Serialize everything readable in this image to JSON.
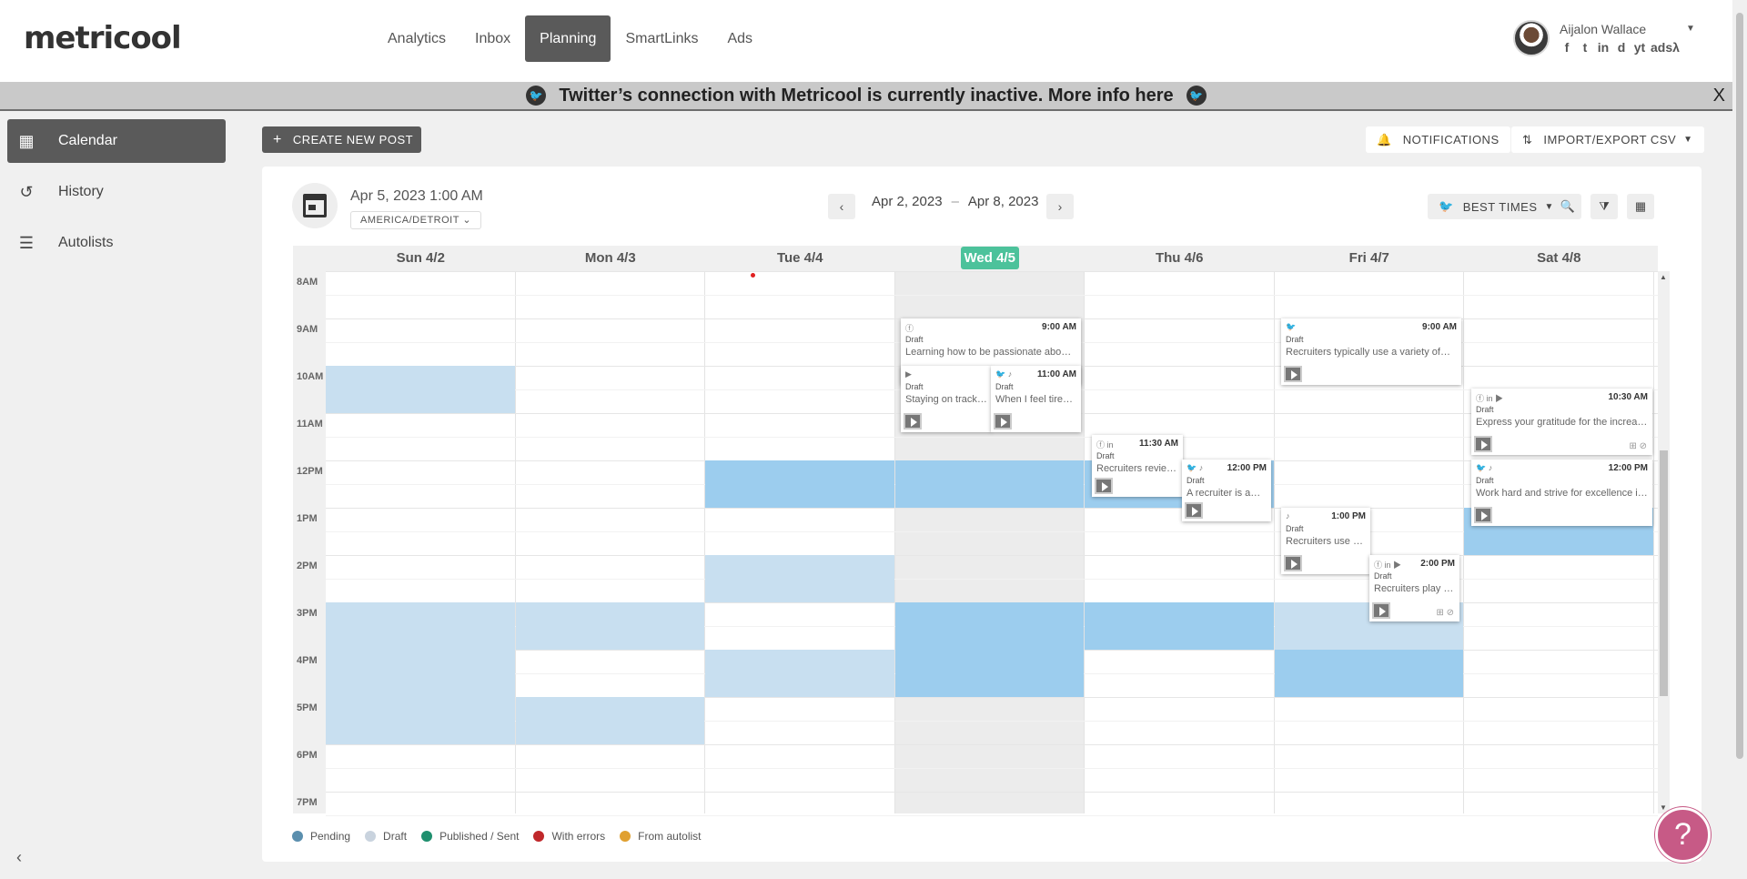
{
  "app": {
    "logo": "metricool"
  },
  "nav": [
    {
      "label": "Analytics",
      "active": false
    },
    {
      "label": "Inbox",
      "active": false
    },
    {
      "label": "Planning",
      "active": true
    },
    {
      "label": "SmartLinks",
      "active": false
    },
    {
      "label": "Ads",
      "active": false
    }
  ],
  "user": {
    "name": "Aijalon Wallace",
    "networks": [
      "f",
      "t",
      "in",
      "d",
      "yt",
      "ads",
      "λ"
    ]
  },
  "banner": {
    "text": "Twitter’s connection with Metricool is currently inactive. More info here",
    "close": "X"
  },
  "sidebar": {
    "items": [
      {
        "label": "Calendar",
        "icon": "calendar-icon",
        "active": true
      },
      {
        "label": "History",
        "icon": "history-icon",
        "active": false
      },
      {
        "label": "Autolists",
        "icon": "list-icon",
        "active": false
      }
    ],
    "collapse": "‹"
  },
  "toolbar": {
    "create": "CREATE NEW POST",
    "notifications": "NOTIFICATIONS",
    "import_export": "IMPORT/EXPORT CSV"
  },
  "calendar": {
    "now": "Apr 5, 2023 1:00 AM",
    "timezone": "AMERICA/DETROIT",
    "range_start": "Apr 2, 2023",
    "range_sep": "–",
    "range_end": "Apr 8, 2023",
    "best_times": "BEST TIMES",
    "days": [
      {
        "label": "Sun 4/2",
        "today": false
      },
      {
        "label": "Mon 4/3",
        "today": false
      },
      {
        "label": "Tue 4/4",
        "today": false
      },
      {
        "label": "Wed 4/5",
        "today": true
      },
      {
        "label": "Thu 4/6",
        "today": false
      },
      {
        "label": "Fri 4/7",
        "today": false
      },
      {
        "label": "Sat 4/8",
        "today": false
      }
    ],
    "hours": [
      "8AM",
      "9AM",
      "10AM",
      "11AM",
      "12PM",
      "1PM",
      "2PM",
      "3PM",
      "4PM",
      "5PM",
      "6PM",
      "7PM"
    ],
    "colors": {
      "light": "#c8dff0",
      "dark": "#9ccdee",
      "today": "#4cc29b"
    }
  },
  "posts": [
    {
      "icons": "ⓕ",
      "time": "9:00 AM",
      "status": "Draft",
      "text": "Learning how to be passionate about…"
    },
    {
      "icons": "▶",
      "time": "",
      "status": "Draft",
      "text": "Staying on track and…"
    },
    {
      "icons": "🐦 ♪",
      "time": "11:00 AM",
      "status": "Draft",
      "text": "When I feel tired, …"
    },
    {
      "icons": "ⓕ in",
      "time": "11:30 AM",
      "status": "Draft",
      "text": "Recruiters review res…"
    },
    {
      "icons": "🐦 ♪",
      "time": "12:00 PM",
      "status": "Draft",
      "text": "A recruiter is a…"
    },
    {
      "icons": "🐦",
      "time": "9:00 AM",
      "status": "Draft",
      "text": "Recruiters typically use a variety of…"
    },
    {
      "icons": "♪",
      "time": "1:00 PM",
      "status": "Draft",
      "text": "Recruiters use a variety of methods to…"
    },
    {
      "icons": "ⓕ in ▶",
      "time": "2:00 PM",
      "status": "Draft",
      "text": "Recruiters play a…"
    },
    {
      "icons": "ⓕ in ▶",
      "time": "10:30 AM",
      "status": "Draft",
      "text": "Express your gratitude for the increase …"
    },
    {
      "icons": "🐦 ♪",
      "time": "12:00 PM",
      "status": "Draft",
      "text": "Work hard and strive for excellence in…"
    }
  ],
  "legend": [
    {
      "label": "Pending",
      "color": "#5b8fae"
    },
    {
      "label": "Draft",
      "color": "#c9d3de"
    },
    {
      "label": "Published / Sent",
      "color": "#1f8f6e"
    },
    {
      "label": "With errors",
      "color": "#c0282b"
    },
    {
      "label": "From autolist",
      "color": "#e0a030"
    }
  ],
  "help": "?"
}
